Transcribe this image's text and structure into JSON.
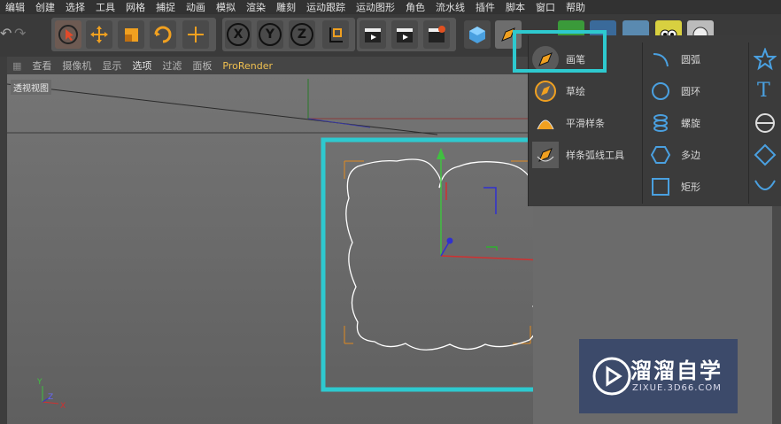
{
  "menu": [
    "编辑",
    "创建",
    "选择",
    "工具",
    "网格",
    "捕捉",
    "动画",
    "模拟",
    "渲染",
    "雕刻",
    "运动跟踪",
    "运动图形",
    "角色",
    "流水线",
    "插件",
    "脚本",
    "窗口",
    "帮助"
  ],
  "toolbar": {
    "axis_buttons": [
      "X",
      "Y",
      "Z"
    ]
  },
  "viewport": {
    "menu": [
      "查看",
      "摄像机",
      "显示",
      "选项",
      "过滤",
      "面板"
    ],
    "renderer": "ProRender",
    "label": "透视视图",
    "axis_labels": [
      "Y",
      "Z",
      "X"
    ]
  },
  "popup": {
    "pen_tools": [
      {
        "label": "画笔",
        "icon": "pen-icon"
      },
      {
        "label": "草绘",
        "icon": "sketch-icon"
      },
      {
        "label": "平滑样条",
        "icon": "smooth-spline-icon"
      },
      {
        "label": "样条弧线工具",
        "icon": "spline-arc-icon"
      }
    ],
    "primitives": [
      {
        "label": "圆弧",
        "icon": "arc-icon"
      },
      {
        "label": "圆环",
        "icon": "circle-icon"
      },
      {
        "label": "螺旋",
        "icon": "helix-icon"
      },
      {
        "label": "多边",
        "icon": "polygon-icon"
      },
      {
        "label": "矩形",
        "icon": "rectangle-icon"
      }
    ],
    "extra_icons": [
      "star-icon",
      "text-icon",
      "cogwheel-icon",
      "diamond-icon",
      "profile-icon"
    ]
  },
  "watermark": {
    "title": "溜溜自学",
    "subtitle": "ZIXUE.3D66.COM"
  },
  "colors": {
    "highlight": "#2ec9cf",
    "arrow": "#e03a2a",
    "spline": "#ffffff",
    "bbox": "#e08a20"
  }
}
